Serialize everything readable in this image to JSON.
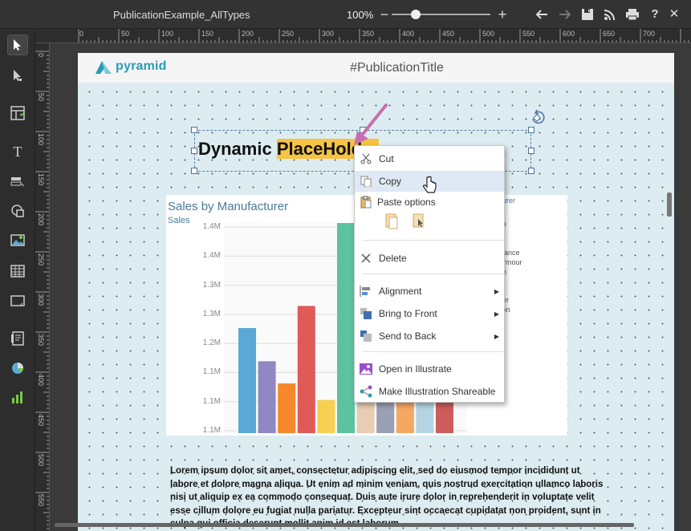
{
  "toolbar": {
    "doc_title": "PublicationExample_AllTypes",
    "zoom": "100%"
  },
  "ruler": {
    "top": [
      "0",
      "50",
      "100",
      "150",
      "200",
      "250",
      "300",
      "350",
      "400",
      "450",
      "500",
      "550",
      "600",
      "650",
      "700"
    ],
    "left": [
      "0",
      "50",
      "100",
      "150",
      "200",
      "250",
      "300",
      "350",
      "400",
      "450",
      "500",
      "550"
    ]
  },
  "page": {
    "logo": "pyramid",
    "title": "#PublicationTitle"
  },
  "dynamic_title": {
    "prefix": "Dynamic ",
    "highlighted": "PlaceHolder"
  },
  "chart": {
    "title": "Sales by Manufacturer",
    "subtitle": "Sales"
  },
  "chart_data": {
    "type": "bar",
    "title": "Sales by Manufacturer",
    "ylabel": "Sales",
    "ylim": [
      1.04,
      1.42
    ],
    "yticks": [
      "1.4M",
      "1.4M",
      "1.3M",
      "1.3M",
      "1.2M",
      "1.1M",
      "1.1M",
      "1.1M"
    ],
    "values": [
      1.23,
      1.17,
      1.13,
      1.27,
      1.1,
      1.43,
      1.13,
      1.13,
      1.13,
      1.13,
      1.13
    ],
    "colors": [
      "#5ba8d8",
      "#8f88c4",
      "#f5882b",
      "#e05a58",
      "#f8cf52",
      "#5cc3a0",
      "#e8cdb4",
      "#9aa0b4",
      "#f5a862",
      "#b4d4e4",
      "#cd5c5c"
    ],
    "legend_title": "cturer",
    "legend": [
      "sh",
      "alance",
      "Armour",
      "ah",
      "k",
      "ger",
      "son"
    ]
  },
  "context_menu": {
    "cut": "Cut",
    "copy": "Copy",
    "paste_options": "Paste options",
    "delete": "Delete",
    "alignment": "Alignment",
    "bring_to_front": "Bring to Front",
    "send_to_back": "Send to Back",
    "open_in_illustrate": "Open in Illustrate",
    "make_shareable": "Make Illustration Shareable"
  },
  "lorem": "Lorem ipsum dolor sit amet, consectetur adipiscing elit, sed do eiusmod tempor incididunt ut labore et dolore magna aliqua. Ut enim ad minim veniam, quis nostrud exercitation ullamco laboris nisi ut aliquip ex ea commodo consequat. Duis aute irure dolor in reprehenderit in voluptate velit esse cillum dolore eu fugiat nulla pariatur. Excepteur sint occaecat cupidatat non proident, sunt in culpa qui officia deserunt mollit anim id est laborum."
}
